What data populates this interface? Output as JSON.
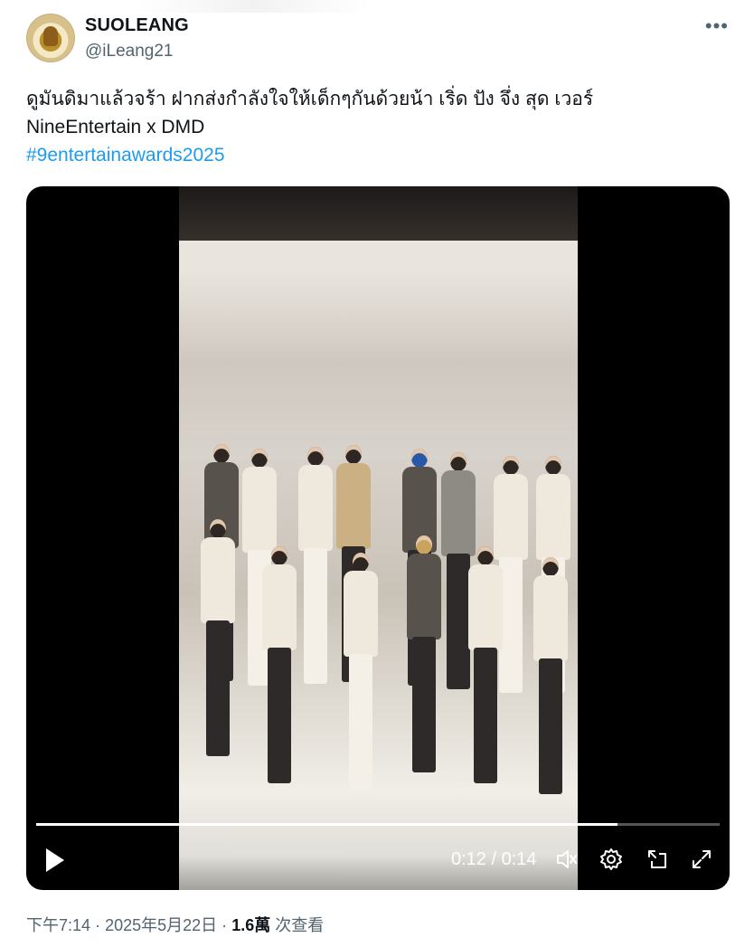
{
  "author": {
    "name": "SUOLEANG",
    "handle": "@iLeang21"
  },
  "post": {
    "line1": "ดูมันดิมาแล้วจร้า ฝากส่งกำลังใจให้เด็กๆกันด้วยน้า เริ่ด ปัง จึ่ง สุด เวอร์",
    "line2": "NineEntertain x DMD",
    "hashtag": "#9entertainawards2025"
  },
  "video": {
    "time": "0:12 / 0:14",
    "progress": 0.85
  },
  "meta": {
    "time": "下午7:14",
    "date": "2025年5月22日",
    "views_count": "1.6萬",
    "views_label": "次查看",
    "separator": "·"
  },
  "icons": {
    "more": "more-icon",
    "play": "play-icon",
    "volume": "volume-icon",
    "settings": "settings-icon",
    "pip": "picture-in-picture-icon",
    "fullscreen": "fullscreen-icon"
  },
  "colors": {
    "link": "#1d9bf0",
    "text": "#0f1419",
    "muted": "#536471"
  }
}
